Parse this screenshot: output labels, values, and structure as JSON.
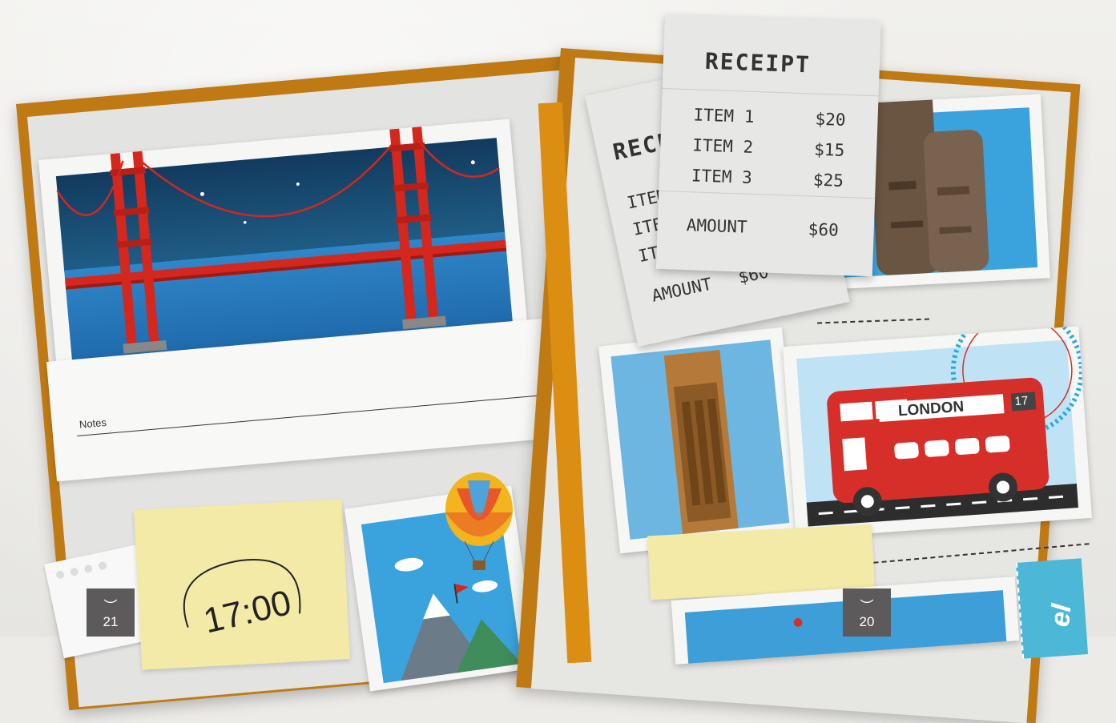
{
  "receipt_front": {
    "title": "RECEIPT",
    "items": [
      {
        "label": "ITEM 1",
        "price": "$20"
      },
      {
        "label": "ITEM 2",
        "price": "$15"
      },
      {
        "label": "ITEM 3",
        "price": "$25"
      }
    ],
    "amount_label": "AMOUNT",
    "amount_value": "$60"
  },
  "receipt_back": {
    "title_partial": "RECE",
    "item_partials": [
      "ITEM",
      "ITEM",
      "ITE"
    ],
    "amount_label": "AMOUNT",
    "amount_value": "$60"
  },
  "notes_label": "Notes",
  "sticky_time": "17:00",
  "bus": {
    "destination": "LONDON",
    "route": "17"
  },
  "page_left_number": "21",
  "page_right_number": "20",
  "travel_tag_partial": "el",
  "colors": {
    "journal_cover": "#c07a14",
    "tape": "#4cb7d6",
    "sticky_note": "#f2eaa6",
    "bridge": "#d4271e",
    "bus": "#d62f2a"
  }
}
